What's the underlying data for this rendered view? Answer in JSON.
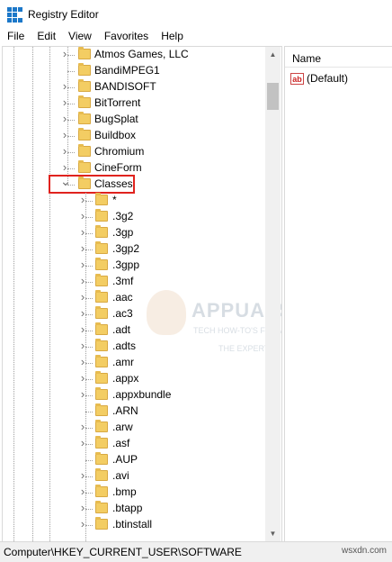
{
  "window": {
    "title": "Registry Editor"
  },
  "menu": [
    "File",
    "Edit",
    "View",
    "Favorites",
    "Help"
  ],
  "tree": {
    "top_items": [
      "Atmos Games, LLC",
      "BandiMPEG1",
      "BANDISOFT",
      "BitTorrent",
      "BugSplat",
      "Buildbox",
      "Chromium",
      "CineForm"
    ],
    "top_has_children": [
      true,
      false,
      true,
      true,
      true,
      true,
      true,
      true
    ],
    "selected": "Classes",
    "children": [
      "*",
      ".3g2",
      ".3gp",
      ".3gp2",
      ".3gpp",
      ".3mf",
      ".aac",
      ".ac3",
      ".adt",
      ".adts",
      ".amr",
      ".appx",
      ".appxbundle",
      ".ARN",
      ".arw",
      ".asf",
      ".AUP",
      ".avi",
      ".bmp",
      ".btapp",
      ".btinstall"
    ],
    "children_has_children": [
      true,
      true,
      true,
      true,
      true,
      true,
      true,
      true,
      true,
      true,
      true,
      true,
      true,
      false,
      true,
      true,
      false,
      true,
      true,
      true,
      true
    ]
  },
  "list": {
    "column_name": "Name",
    "rows": [
      {
        "name": "(Default)"
      }
    ]
  },
  "statusbar": {
    "path": "Computer\\HKEY_CURRENT_USER\\SOFTWARE"
  },
  "watermark": {
    "brand": "APPUALS",
    "line1": "TECH HOW-TO'S FROM",
    "line2": "THE EXPERTS"
  },
  "site": "wsxdn.com",
  "colors": {
    "selection_box": "#e0231e",
    "folder": "#f3cd63"
  },
  "icons": {
    "expand": "chevron-right-icon",
    "collapse": "chevron-down-icon",
    "folder": "folder-icon",
    "string_value": "ab-string-icon"
  }
}
